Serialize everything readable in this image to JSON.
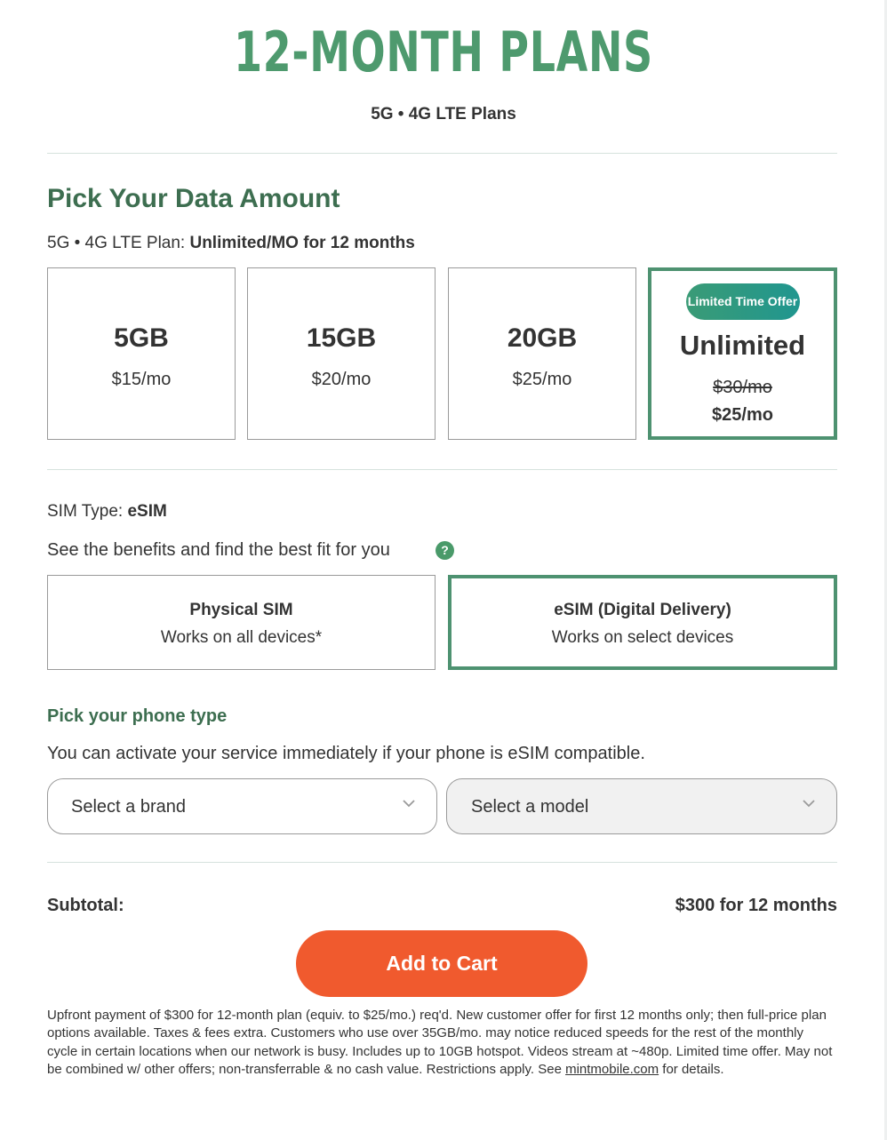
{
  "header": {
    "title": "12-MONTH PLANS",
    "subtitle": "5G • 4G LTE Plans"
  },
  "data_section": {
    "heading": "Pick Your Data Amount",
    "plan_prefix": "5G • 4G LTE Plan: ",
    "plan_value": "Unlimited/MO for 12 months",
    "plans": [
      {
        "amount": "5GB",
        "price": "$15/mo"
      },
      {
        "amount": "15GB",
        "price": "$20/mo"
      },
      {
        "amount": "20GB",
        "price": "$25/mo"
      },
      {
        "amount": "Unlimited",
        "badge": "Limited Time Offer",
        "old_price": "$30/mo",
        "price": "$25/mo",
        "selected": true
      }
    ]
  },
  "sim_section": {
    "label": "SIM Type: ",
    "value": "eSIM",
    "benefits_text": "See the benefits and find the best fit for you",
    "help_icon": "?",
    "options": [
      {
        "name": "Physical SIM",
        "desc": "Works on all devices*"
      },
      {
        "name": "eSIM (Digital Delivery)",
        "desc": "Works on select devices",
        "selected": true
      }
    ]
  },
  "phone_section": {
    "heading": "Pick your phone type",
    "text": "You can activate your service immediately if your phone is eSIM compatible.",
    "brand_placeholder": "Select a brand",
    "model_placeholder": "Select a model"
  },
  "summary": {
    "subtotal_label": "Subtotal:",
    "subtotal_value": "$300 for 12 months",
    "cart_button": "Add to Cart"
  },
  "disclaimer": {
    "text": "Upfront payment of $300 for 12-month plan (equiv. to $25/mo.) req'd. New customer offer for first 12 months only; then full-price plan options available. Taxes & fees extra. Customers who use over 35GB/mo. may notice reduced speeds for the rest of the monthly cycle in certain locations when our network is busy. Includes up to 10GB hotspot. Videos stream at ~480p. Limited time offer. May not be combined w/ other offers; non-transferrable & no cash value. Restrictions apply. See ",
    "link": "mintmobile.com",
    "suffix": " for details."
  },
  "colors": {
    "brand_green": "#4e9a6e",
    "selected_border": "#4e9271",
    "cta_orange": "#f05a2e"
  }
}
